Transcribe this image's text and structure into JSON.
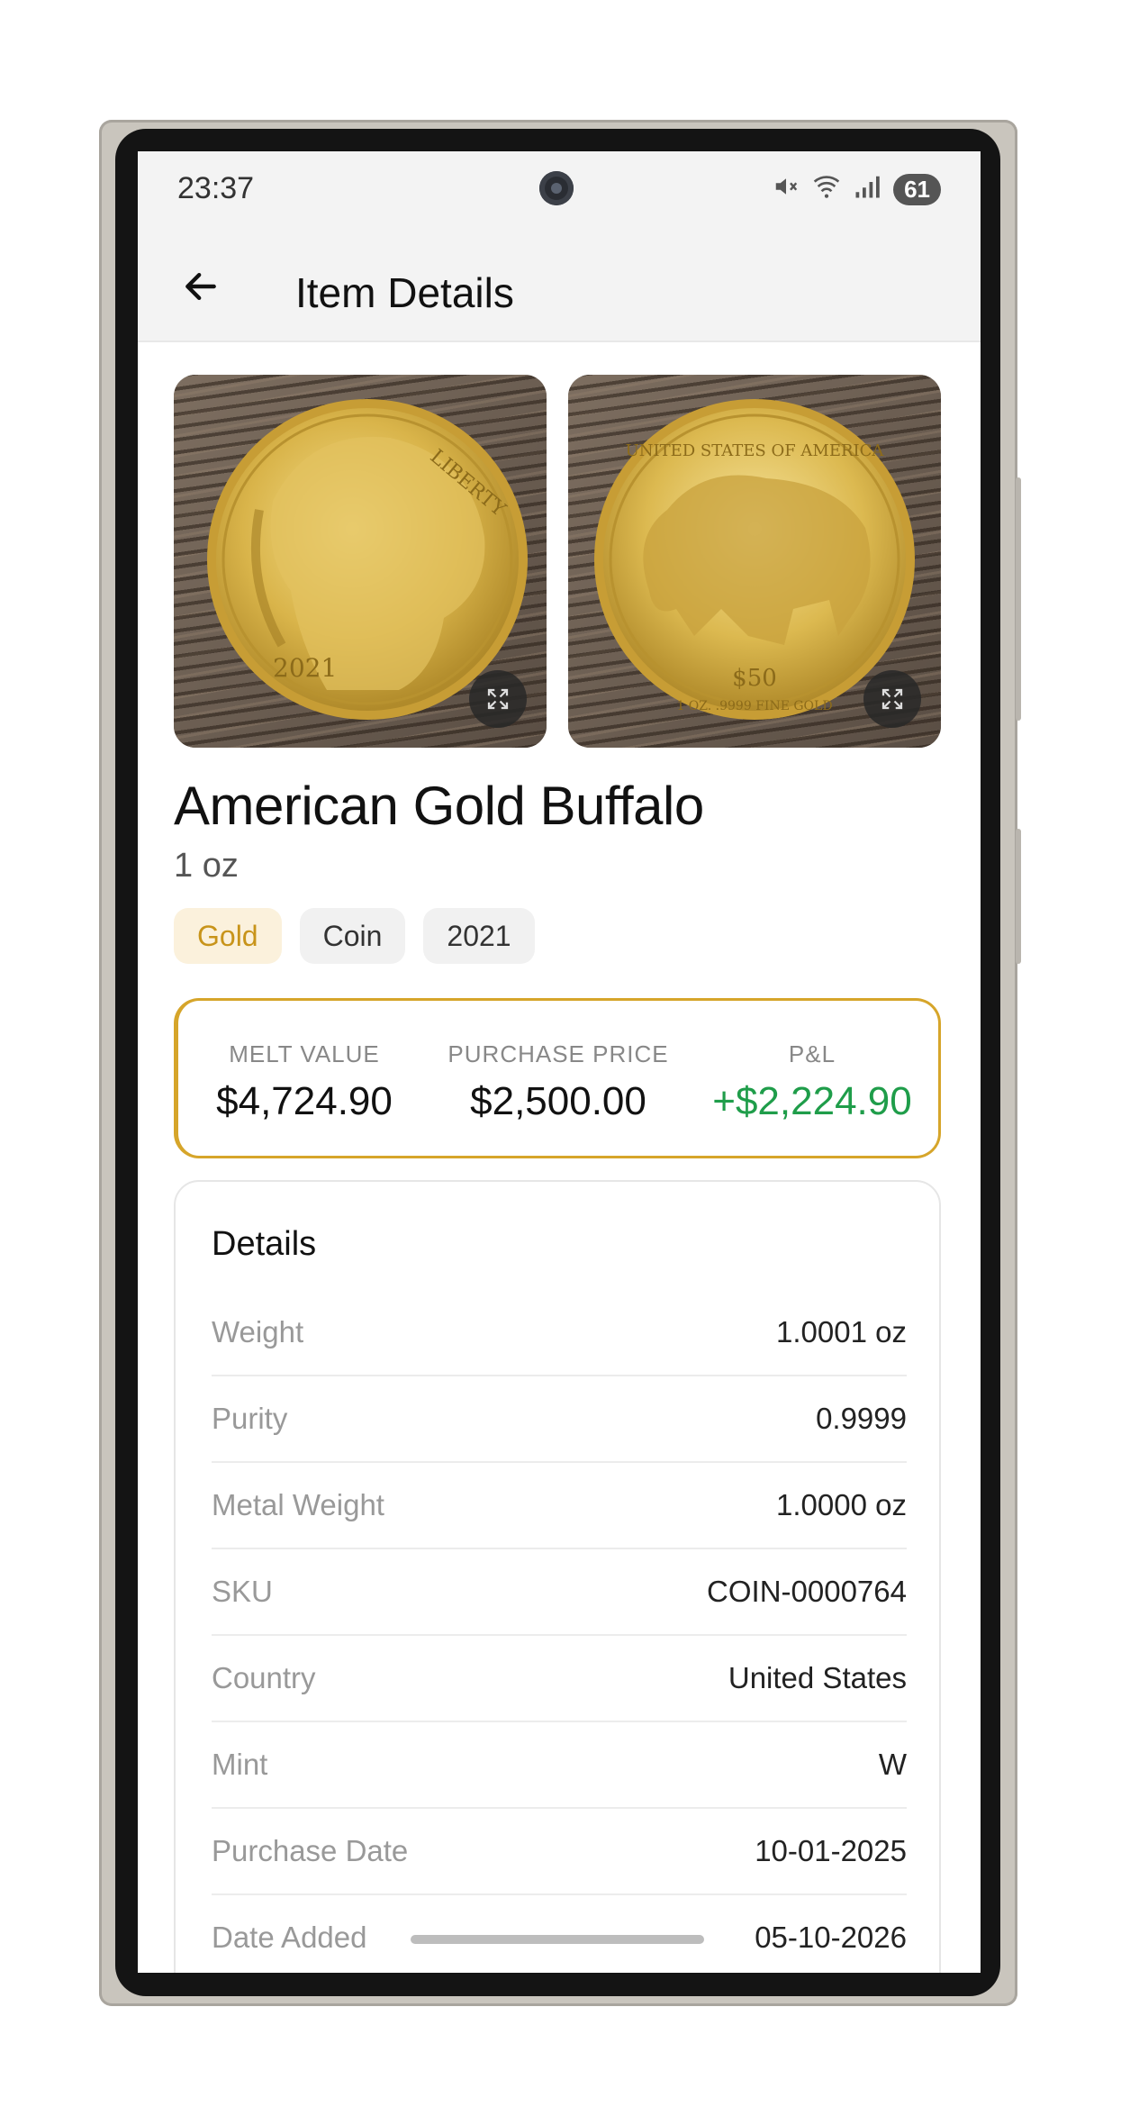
{
  "status_bar": {
    "time": "23:37",
    "battery": "61"
  },
  "app_bar": {
    "title": "Item Details"
  },
  "photos": [
    {
      "label": "obverse",
      "year_text": "2021",
      "legend": "LIBERTY"
    },
    {
      "label": "reverse",
      "legend": "UNITED STATES OF AMERICA",
      "denomination": "$50",
      "inscription": "1 OZ. .9999 FINE GOLD"
    }
  ],
  "item": {
    "name": "American Gold Buffalo",
    "weight_label": "1 oz"
  },
  "chips": [
    "Gold",
    "Coin",
    "2021"
  ],
  "summary": {
    "melt_label": "MELT VALUE",
    "melt_value": "$4,724.90",
    "purchase_label": "PURCHASE PRICE",
    "purchase_value": "$2,500.00",
    "pl_label": "P&L",
    "pl_value": "+$2,224.90"
  },
  "details": {
    "title": "Details",
    "rows": [
      {
        "key": "Weight",
        "value": "1.0001 oz"
      },
      {
        "key": "Purity",
        "value": "0.9999"
      },
      {
        "key": "Metal Weight",
        "value": "1.0000 oz"
      },
      {
        "key": "SKU",
        "value": "COIN-0000764"
      },
      {
        "key": "Country",
        "value": "United States"
      },
      {
        "key": "Mint",
        "value": "W"
      },
      {
        "key": "Purchase Date",
        "value": "10-01-2025"
      },
      {
        "key": "Date Added",
        "value": "05-10-2026"
      }
    ]
  },
  "colors": {
    "gold_accent": "#d6a52a",
    "positive": "#1f9d4a",
    "chip_gold_bg": "#fbf1dc",
    "chip_gold_text": "#c8941a"
  }
}
